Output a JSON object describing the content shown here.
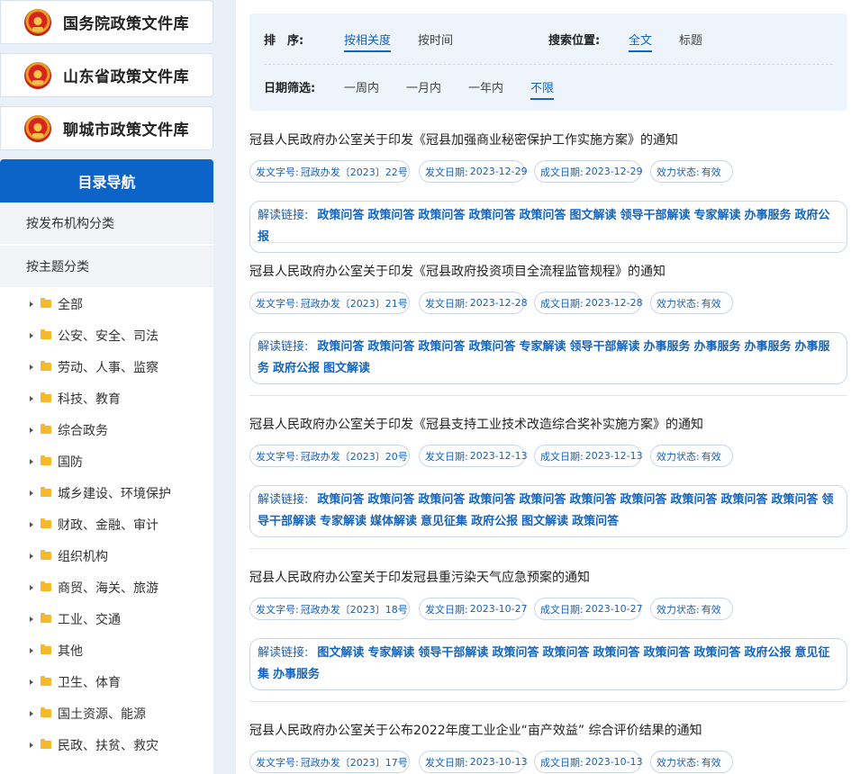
{
  "sidebar": {
    "libraries": [
      {
        "label": "国务院政策文件库"
      },
      {
        "label": "山东省政策文件库"
      },
      {
        "label": "聊城市政策文件库"
      }
    ],
    "nav_title": "目录导航",
    "categories": [
      "按发布机构分类",
      "按主题分类"
    ],
    "tree": [
      "全部",
      "公安、安全、司法",
      "劳动、人事、监察",
      "科技、教育",
      "综合政务",
      "国防",
      "城乡建设、环境保护",
      "财政、金融、审计",
      "组织机构",
      "商贸、海关、旅游",
      "工业、交通",
      "其他",
      "卫生、体育",
      "国土资源、能源",
      "民政、扶贫、救灾"
    ]
  },
  "filters": {
    "sort_label": "排　序:",
    "sort_options": [
      "按相关度",
      "按时间"
    ],
    "sort_active": 0,
    "position_label": "搜索位置:",
    "position_options": [
      "全文",
      "标题"
    ],
    "position_active": 0,
    "date_label": "日期筛选:",
    "date_options": [
      "一周内",
      "一月内",
      "一年内",
      "不限"
    ],
    "date_active": 3
  },
  "labels": {
    "doc_no": "发文字号:",
    "pub_date": "发文日期:",
    "doc_date": "成文日期:",
    "status": "效力状态:",
    "links": "解读链接:"
  },
  "documents": [
    {
      "title": "冠县人民政府办公室关于印发《冠县加强商业秘密保护工作实施方案》的通知",
      "doc_no": "冠政办发〔2023〕22号",
      "pub_date": "2023-12-29",
      "doc_date": "2023-12-29",
      "status": "有效",
      "links": [
        "政策问答",
        "政策问答",
        "政策问答",
        "政策问答",
        "政策问答",
        "图文解读",
        "领导干部解读",
        "专家解读",
        "办事服务",
        "政府公报"
      ]
    },
    {
      "title": "冠县人民政府办公室关于印发《冠县政府投资项目全流程监管规程》的通知",
      "doc_no": "冠政办发〔2023〕21号",
      "pub_date": "2023-12-28",
      "doc_date": "2023-12-28",
      "status": "有效",
      "links": [
        "政策问答",
        "政策问答",
        "政策问答",
        "政策问答",
        "专家解读",
        "领导干部解读",
        "办事服务",
        "办事服务",
        "办事服务",
        "办事服务",
        "政府公报",
        "图文解读"
      ]
    },
    {
      "title": "冠县人民政府办公室关于印发《冠县支持工业技术改造综合奖补实施方案》的通知",
      "doc_no": "冠政办发〔2023〕20号",
      "pub_date": "2023-12-13",
      "doc_date": "2023-12-13",
      "status": "有效",
      "links": [
        "政策问答",
        "政策问答",
        "政策问答",
        "政策问答",
        "政策问答",
        "政策问答",
        "政策问答",
        "政策问答",
        "政策问答",
        "政策问答",
        "领导干部解读",
        "专家解读",
        "媒体解读",
        "意见征集",
        "政府公报",
        "图文解读",
        "政策问答"
      ]
    },
    {
      "title": "冠县人民政府办公室关于印发冠县重污染天气应急预案的通知",
      "doc_no": "冠政办发〔2023〕18号",
      "pub_date": "2023-10-27",
      "doc_date": "2023-10-27",
      "status": "有效",
      "links": [
        "图文解读",
        "专家解读",
        "领导干部解读",
        "政策问答",
        "政策问答",
        "政策问答",
        "政策问答",
        "政策问答",
        "政府公报",
        "意见征集",
        "办事服务"
      ]
    },
    {
      "title": "冠县人民政府办公室关于公布2022年度工业企业“亩产效益” 综合评价结果的通知",
      "doc_no": "冠政办发〔2023〕17号",
      "pub_date": "2023-10-13",
      "doc_date": "2023-10-13",
      "status": "有效",
      "links": []
    }
  ]
}
